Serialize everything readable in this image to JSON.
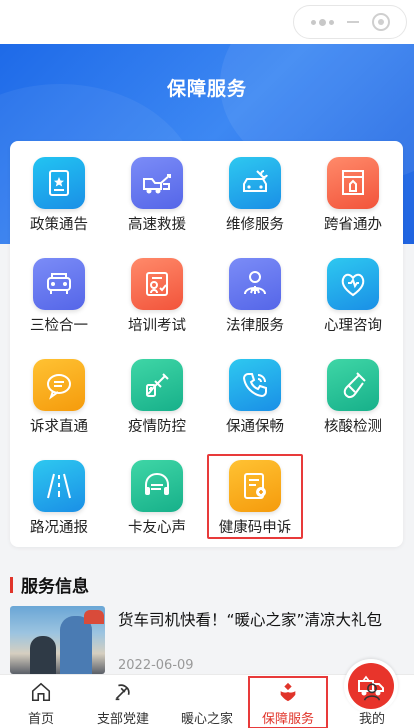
{
  "page": {
    "title": "保障服务"
  },
  "services": [
    {
      "label": "政策通告",
      "icon": "document-star-icon",
      "color_top": "#22c4f2",
      "color_bottom": "#1a8fe6"
    },
    {
      "label": "高速救援",
      "icon": "tow-truck-icon",
      "color_top": "#7b8cf7",
      "color_bottom": "#5566e8"
    },
    {
      "label": "维修服务",
      "icon": "wrench-car-icon",
      "color_top": "#2ec8f0",
      "color_bottom": "#1a8fe6"
    },
    {
      "label": "跨省通办",
      "icon": "government-building-icon",
      "color_top": "#ff8a6a",
      "color_bottom": "#f2543b"
    },
    {
      "label": "三检合一",
      "icon": "vehicle-inspection-icon",
      "color_top": "#7b8cf7",
      "color_bottom": "#5566e8"
    },
    {
      "label": "培训考试",
      "icon": "exam-certificate-icon",
      "color_top": "#ff8a6a",
      "color_bottom": "#f2543b"
    },
    {
      "label": "法律服务",
      "icon": "legal-scale-icon",
      "color_top": "#7b8cf7",
      "color_bottom": "#5566e8"
    },
    {
      "label": "心理咨询",
      "icon": "heart-stethoscope-icon",
      "color_top": "#2ec8f0",
      "color_bottom": "#1a8fe6"
    },
    {
      "label": "诉求直通",
      "icon": "chat-bubble-icon",
      "color_top": "#ffc233",
      "color_bottom": "#f59b0c"
    },
    {
      "label": "疫情防控",
      "icon": "syringe-icon",
      "color_top": "#3fd6a6",
      "color_bottom": "#17b08a"
    },
    {
      "label": "保通保畅",
      "icon": "phone-call-icon",
      "color_top": "#2ec8f0",
      "color_bottom": "#1a8fe6"
    },
    {
      "label": "核酸检测",
      "icon": "test-tube-icon",
      "color_top": "#3fd6a6",
      "color_bottom": "#17b08a"
    },
    {
      "label": "路况通报",
      "icon": "road-icon",
      "color_top": "#2ec8f0",
      "color_bottom": "#1a8fe6"
    },
    {
      "label": "卡友心声",
      "icon": "headset-icon",
      "color_top": "#3fd6a6",
      "color_bottom": "#17b08a"
    },
    {
      "label": "健康码申诉",
      "icon": "health-code-icon",
      "color_top": "#ffc233",
      "color_bottom": "#f59b0c"
    }
  ],
  "section": {
    "title": "服务信息"
  },
  "news": {
    "headline": "货车司机快看！“暖心之家”清凉大礼包",
    "date": "2022-06-09"
  },
  "tabbar": {
    "items": [
      {
        "label": "首页",
        "icon": "home-icon"
      },
      {
        "label": "支部党建",
        "icon": "party-emblem-icon"
      },
      {
        "label": "暖心之家",
        "icon": "truck-home-icon"
      },
      {
        "label": "保障服务",
        "icon": "service-shield-icon",
        "active": true
      },
      {
        "label": "我的",
        "icon": "user-icon"
      }
    ]
  },
  "colors": {
    "accent": "#e0342a",
    "hero": "#2f7bf0",
    "highlight": "#e83a3a"
  }
}
